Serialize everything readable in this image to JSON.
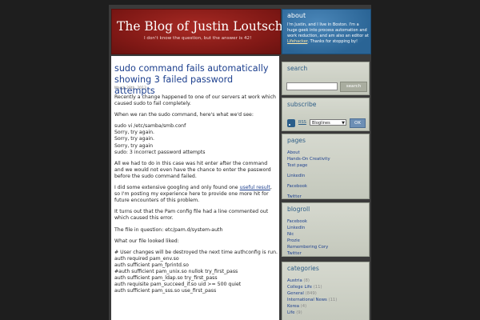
{
  "header": {
    "title": "The Blog of Justin Loutsch",
    "tagline": "I don't know the question, but the answer is 42!"
  },
  "about": {
    "heading": "about",
    "text_before": "I'm Justin, and I live in Boston. I'm a huge geek into process automation and work reduction, and am also an editor at ",
    "link": "Lifehacker",
    "text_after": ". Thanks for stopping by!"
  },
  "post": {
    "title": "sudo command fails automatically showing 3 failed password attempts",
    "date": "March 28th, 2013",
    "p1": "Recently a change happened to one of our servers at work which caused sudo to fail completely.",
    "p2": "When we ran the sudo command, here's what we'd see:",
    "code1": [
      "sudo vi /etc/samba/smb.conf",
      "Sorry, try again.",
      "Sorry, try again.",
      "Sorry, try again",
      "sudo: 3 incorrect password attempts"
    ],
    "p3": "All we had to do in this case was hit enter after the command and we would not even have the chance to enter the password before the sudo command failed.",
    "p4_before": "I did some extensive googling and only found one ",
    "p4_link": "useful result",
    "p4_after": ", so I'm posting my experience here to provide one more hit for future encounters of this problem.",
    "p5": "It turns out that the Pam config file had a line commented out which caused this error.",
    "p6": "The file in question: etc/pam.d/system-auth",
    "p7": "What our file looked liked:",
    "code2": [
      "# User changes will be destroyed the next time authconfig is run.",
      "auth required pam_env.so",
      "auth sufficient pam_fprintd.so",
      "#auth sufficient pam_unix.so nullok try_first_pass",
      "auth sufficient pam_ldap.so try_first_pass",
      "auth requisite pam_succeed_if.so uid >= 500 quiet",
      "auth sufficient pam_sss.so use_first_pass"
    ]
  },
  "sidebar": {
    "search": {
      "heading": "search",
      "placeholder": "",
      "button": "search"
    },
    "subscribe": {
      "heading": "subscribe",
      "rss": "RSS",
      "selected": "Bloglines",
      "ok": "OK"
    },
    "pages": {
      "heading": "pages",
      "items": [
        "About",
        "Hands-On Creativity",
        "Test page",
        "LinkedIn",
        "Facebook",
        "Twitter"
      ]
    },
    "blogroll": {
      "heading": "blogroll",
      "items": [
        "Facebook",
        "LinkedIn",
        "Nic",
        "Prozie",
        "Remembering Cory",
        "Twitter"
      ]
    },
    "categories": {
      "heading": "categories",
      "items": [
        {
          "name": "Austria",
          "count": "(8)"
        },
        {
          "name": "College Life",
          "count": "(11)"
        },
        {
          "name": "General",
          "count": "(849)"
        },
        {
          "name": "International News",
          "count": "(11)"
        },
        {
          "name": "Korea",
          "count": "(4)"
        },
        {
          "name": "Life",
          "count": "(9)"
        }
      ]
    }
  },
  "colors": {
    "header_red": "#8c1e1a",
    "about_blue": "#2e6da0",
    "link_blue": "#1c3f8e",
    "widget_bg": "#cfd3c8"
  }
}
